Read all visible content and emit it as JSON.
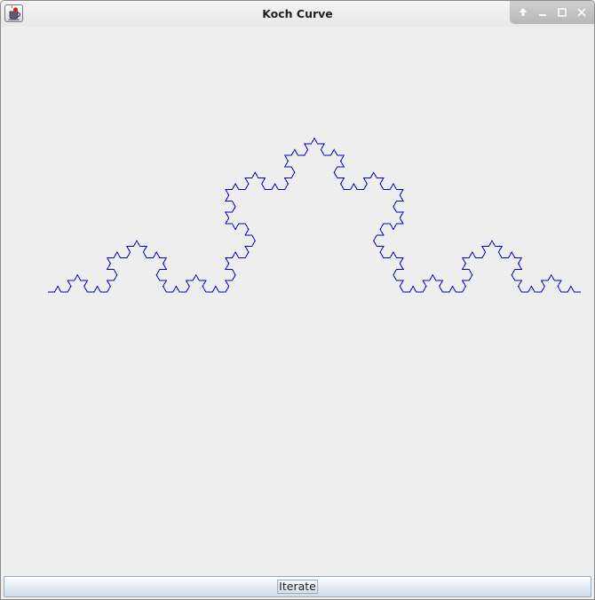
{
  "window": {
    "title": "Koch Curve",
    "icon": "java-app-icon",
    "controls": [
      "pin-icon",
      "minimize-icon",
      "maximize-icon",
      "close-icon"
    ]
  },
  "drawing": {
    "shape": "Koch curve",
    "iterations": 4,
    "stroke_color": "#0000cc",
    "background_color": "#eeeeee"
  },
  "buttons": {
    "iterate_label": "Iterate"
  }
}
